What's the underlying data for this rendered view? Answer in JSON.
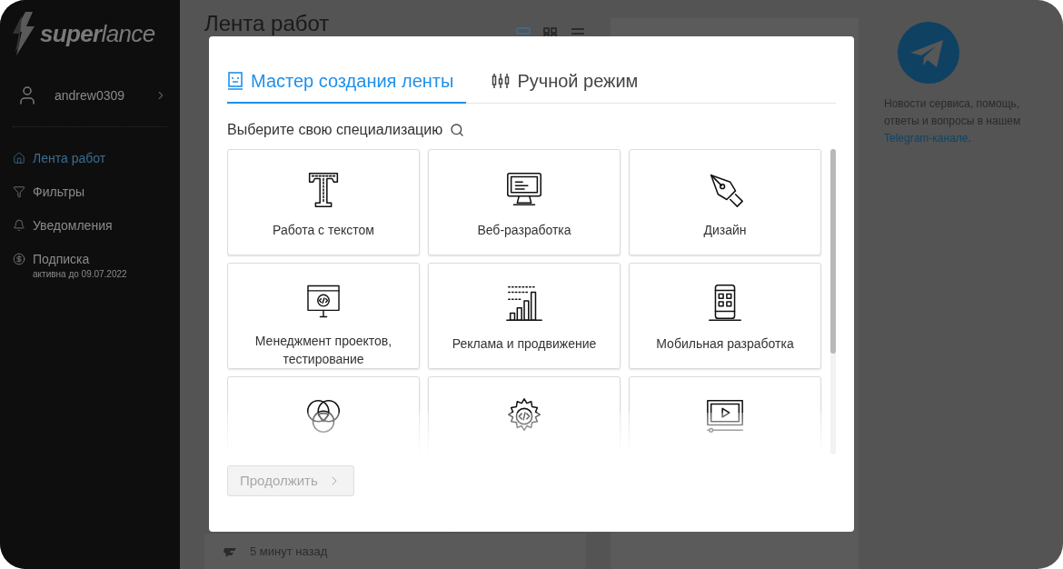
{
  "sidebar": {
    "logo": "**super**lance",
    "user": "andrew0309",
    "items": [
      {
        "label": "Лента работ",
        "selected": true
      },
      {
        "label": "Фильтры",
        "selected": false
      },
      {
        "label": "Уведомления",
        "selected": false
      },
      {
        "label": "Подписка",
        "sublabel": "активна до 09.07.2022",
        "selected": false
      }
    ]
  },
  "page": {
    "title": "Лента работ",
    "view_modes": [
      {
        "selected": true
      },
      {
        "selected": false
      },
      {
        "selected": false
      }
    ],
    "footer_time": "5 минут назад"
  },
  "telegram": {
    "text": "Новости сервиса, помощь, ответы и вопросы в нашем",
    "link": "Telegram-канале",
    "after": "."
  },
  "modal": {
    "tabs": [
      {
        "label": "Мастер создания ленты",
        "selected": true
      },
      {
        "label": "Ручной режим",
        "selected": false
      }
    ],
    "prompt": "Выберите свою специализацию",
    "categories": [
      {
        "kind": "full",
        "label": "Работа с текстом"
      },
      {
        "kind": "full",
        "label": "Веб-разработка"
      },
      {
        "kind": "full",
        "label": "Дизайн"
      },
      {
        "kind": "full",
        "label": "Менеджмент проектов, тестирование"
      },
      {
        "kind": "full",
        "label": "Реклама и продвижение"
      },
      {
        "kind": "full",
        "label": "Мобильная разработка"
      },
      {
        "kind": "cut"
      },
      {
        "kind": "cut"
      },
      {
        "kind": "cut"
      }
    ],
    "continue_button": {
      "label": "Продолжить",
      "disabled": true
    }
  }
}
